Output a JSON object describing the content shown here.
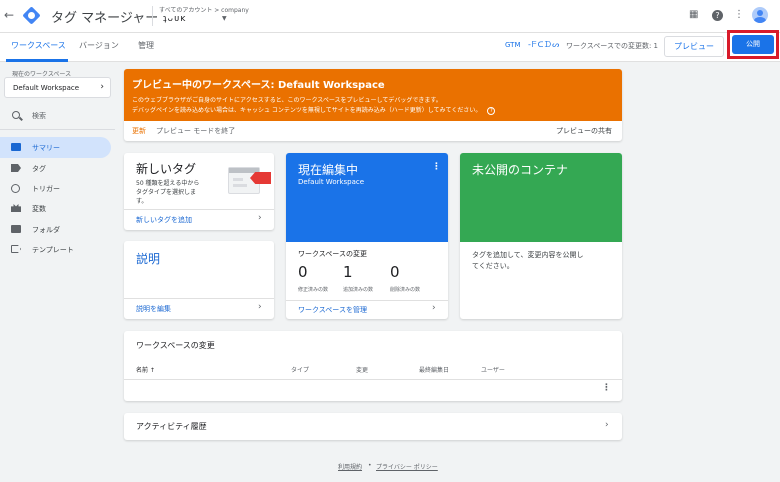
{
  "app": {
    "title": "タグ マネージャー",
    "back_glyph": "←"
  },
  "breadcrumb": {
    "account_path": "すべてのアカウント > company",
    "container_name": "ʇᴗᴜᴋ"
  },
  "tabs": [
    {
      "label": "ワークスペース",
      "active": true
    },
    {
      "label": "バージョン"
    },
    {
      "label": "管理"
    }
  ],
  "header": {
    "gtm_prefix": "GTM",
    "gtm_id_obscured": "-ᖴᑕᗪᔕ",
    "changes_text": "ワークスペースでの変更数: 1",
    "preview_label": "プレビュー",
    "publish_label": "公開"
  },
  "sidebar": {
    "workspace_label": "現在のワークスペース",
    "workspace_name": "Default Workspace",
    "search_label": "検索",
    "items": [
      {
        "label": "サマリー",
        "active": true
      },
      {
        "label": "タグ"
      },
      {
        "label": "トリガー"
      },
      {
        "label": "変数"
      },
      {
        "label": "フォルダ"
      },
      {
        "label": "テンプレート"
      }
    ]
  },
  "banner": {
    "title": "プレビュー中のワークスペース: Default Workspace",
    "line1": "このウェブブラウザがご自身のサイトにアクセスすると、このワークスペースをプレビューしてデバッグできます。",
    "line2": "デバッグペインを読み込めない場合は、キャッシュ コンテンツを無視してサイトを再読み込み（ハード更新）してみてください。",
    "refresh": "更新",
    "exit_preview": "プレビュー モードを終了",
    "share_preview": "プレビューの共有",
    "color": "#ea7100"
  },
  "new_tag_card": {
    "title": "新しいタグ",
    "desc_line1": "50 種類を超える中から",
    "desc_line2": "タグタイプを選択しま",
    "desc_line3": "す。",
    "link": "新しいタグを追加"
  },
  "description_card": {
    "title": "説明",
    "link": "説明を編集"
  },
  "editing_card": {
    "title": "現在編集中",
    "workspace": "Default Workspace",
    "changes_title": "ワークスペースの変更",
    "stats": [
      {
        "value": "0",
        "label": "修正済みの数"
      },
      {
        "value": "1",
        "label": "追加済みの数"
      },
      {
        "value": "0",
        "label": "削除済みの数"
      }
    ],
    "link": "ワークスペースを管理",
    "color": "#1a73e8"
  },
  "unpublished_card": {
    "title": "未公開のコンテナ",
    "desc_line1": "タグを追加して、変更内容を公開し",
    "desc_line2": "てください。",
    "color": "#34a853"
  },
  "changes_table": {
    "title": "ワークスペースの変更",
    "columns": [
      "名前 ↑",
      "タイプ",
      "変更",
      "最終編集日",
      "ユーザー"
    ]
  },
  "activity": {
    "title": "アクティビティ履歴"
  },
  "footer": {
    "terms": "利用規約",
    "separator": "•",
    "privacy": "プライバシー ポリシー"
  }
}
